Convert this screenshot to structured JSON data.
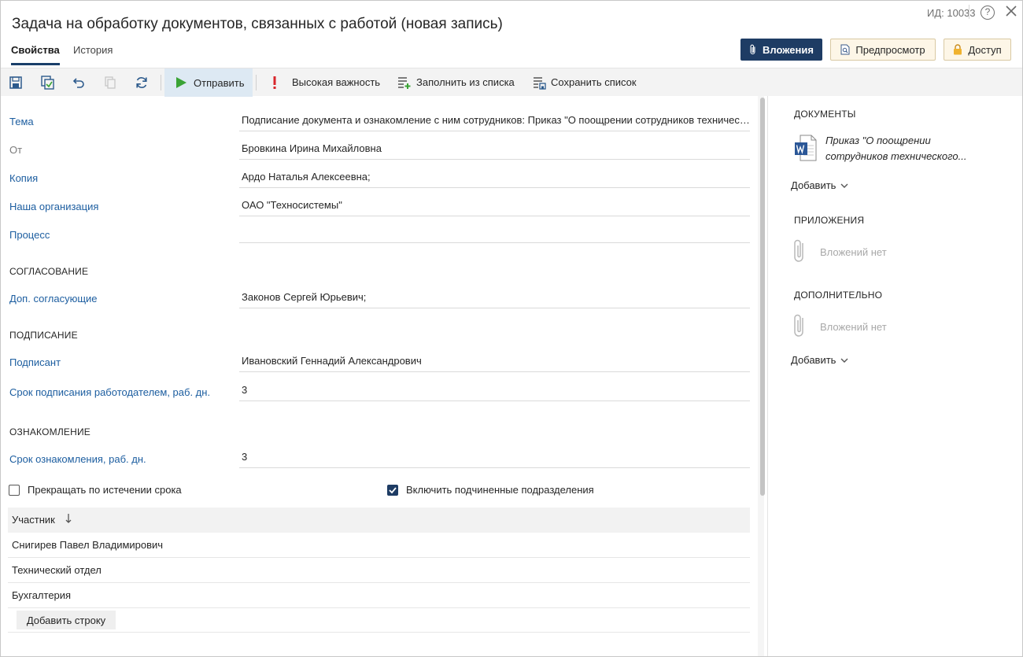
{
  "header": {
    "title": "Задача на обработку документов, связанных с работой (новая запись)",
    "id_label": "ИД: 10033",
    "help_glyph": "?",
    "tabs": [
      {
        "label": "Свойства",
        "active": true
      },
      {
        "label": "История",
        "active": false
      }
    ],
    "buttons": {
      "attachments": "Вложения",
      "preview": "Предпросмотр",
      "access": "Доступ"
    }
  },
  "toolbar": {
    "send": "Отправить",
    "high_importance": "Высокая важность",
    "fill_from_list": "Заполнить из списка",
    "save_list": "Сохранить список",
    "icons": [
      "save-icon",
      "save-and-close-icon",
      "undo-icon",
      "copy-icon",
      "refresh-icon",
      "play-icon",
      "exclamation-icon",
      "fill-list-icon",
      "save-list-icon"
    ]
  },
  "form": {
    "fields": [
      {
        "label": "Тема",
        "value": "Подписание документа и ознакомление с ним сотрудников: Приказ \"О поощрении сотрудников технического отдела\""
      },
      {
        "label": "От",
        "value": "Бровкина Ирина Михайловна"
      },
      {
        "label": "Копия",
        "value": "Ардо Наталья Алексеевна;"
      },
      {
        "label": "Наша организация",
        "value": "ОАО \"Техносистемы\""
      },
      {
        "label": "Процесс",
        "value": ""
      }
    ],
    "approval": {
      "title": "СОГЛАСОВАНИЕ",
      "label": "Доп. согласующие",
      "value": "Законов Сергей Юрьевич;"
    },
    "signing": {
      "title": "ПОДПИСАНИЕ",
      "signer_label": "Подписант",
      "signer_value": "Ивановский Геннадий Александрович",
      "term_label": "Срок подписания работодателем, раб. дн.",
      "term_value": "3"
    },
    "acquaintance": {
      "title": "ОЗНАКОМЛЕНИЕ",
      "term_label": "Срок ознакомления, раб. дн.",
      "term_value": "3",
      "stop_on_expire": {
        "label": "Прекращать по истечении срока",
        "checked": false
      },
      "include_sub": {
        "label": "Включить подчиненные подразделения",
        "checked": true
      }
    },
    "participants": {
      "column": "Участник",
      "rows": [
        "Снигирев Павел Владимирович",
        "Технический отдел",
        "Бухгалтерия"
      ],
      "add_row": "Добавить строку"
    }
  },
  "right_pane": {
    "documents_title": "ДОКУМЕНТЫ",
    "document_name": "Приказ \"О поощрении сотрудников технического...",
    "add": "Добавить",
    "appendices_title": "ПРИЛОЖЕНИЯ",
    "no_attachments": "Вложений нет",
    "additional_title": "ДОПОЛНИТЕЛЬНО",
    "no_attachments_2": "Вложений нет",
    "add_2": "Добавить"
  },
  "colors": {
    "accent": "#1e3c64",
    "link": "#1d5ea0",
    "send_green": "#3aa335",
    "importance_red": "#d8262b",
    "word_blue": "#2b5797"
  }
}
